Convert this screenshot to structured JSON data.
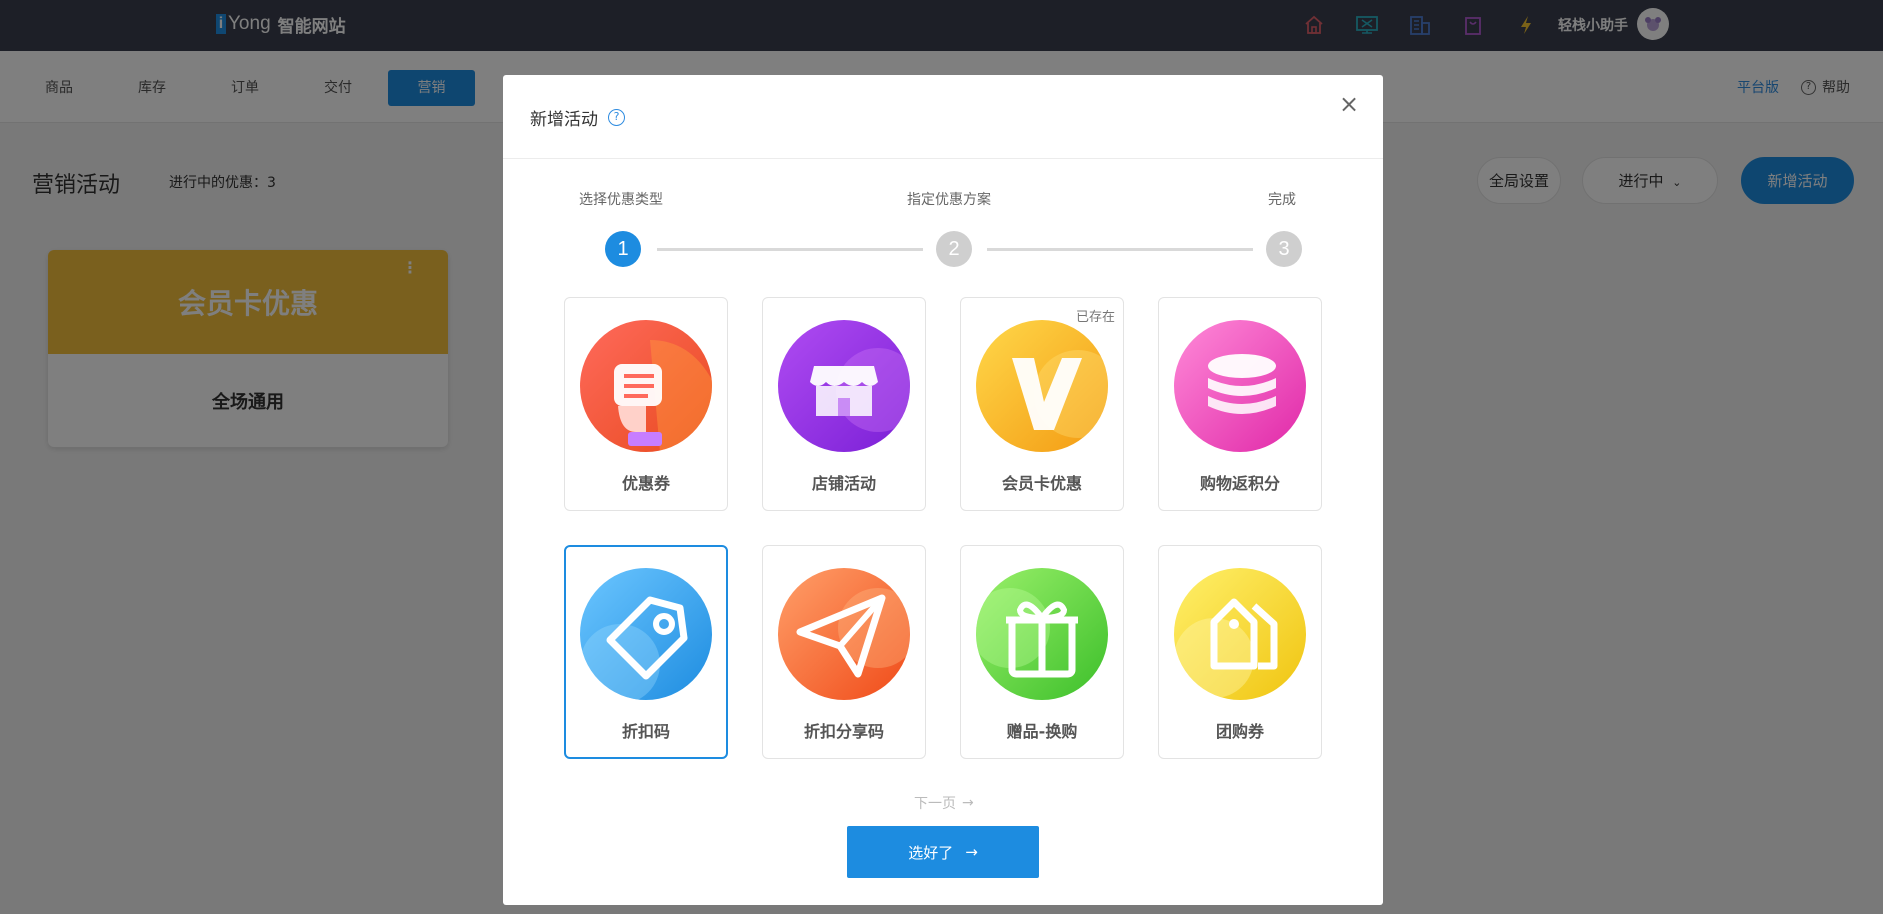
{
  "topbar": {
    "logo_i": "i",
    "logo_brand": "Yong",
    "logo_site": "智能网站",
    "icons": [
      "home-icon",
      "monitor-icon",
      "building-icon",
      "bag-icon",
      "lightning-icon"
    ],
    "assistant": "轻栈小助手"
  },
  "subnav": {
    "tabs": [
      "商品",
      "库存",
      "订单",
      "交付",
      "营销"
    ],
    "active_tab": "营销",
    "platform": "平台版",
    "help": "帮助"
  },
  "page": {
    "title": "营销活动",
    "ongoing_count": "进行中的优惠：3",
    "global_settings": "全局设置",
    "status_filter": "进行中",
    "new_activity": "新增活动"
  },
  "card": {
    "title": "会员卡优惠",
    "subtitle": "全场通用"
  },
  "modal": {
    "title": "新增活动",
    "steps": [
      {
        "label": "选择优惠类型",
        "number": "1"
      },
      {
        "label": "指定优惠方案",
        "number": "2"
      },
      {
        "label": "完成",
        "number": "3"
      }
    ],
    "current_step": 1,
    "types": [
      {
        "label": "优惠券",
        "icon": "coupon-icon"
      },
      {
        "label": "店铺活动",
        "icon": "shop-icon"
      },
      {
        "label": "会员卡优惠",
        "icon": "vip-card-icon",
        "tag": "已存在"
      },
      {
        "label": "购物返积分",
        "icon": "coin-stack-icon"
      },
      {
        "label": "折扣码",
        "icon": "tag-icon"
      },
      {
        "label": "折扣分享码",
        "icon": "paper-plane-icon"
      },
      {
        "label": "赠品-换购",
        "icon": "gift-icon"
      },
      {
        "label": "团购券",
        "icon": "group-tags-icon"
      }
    ],
    "selected_type": "折扣码",
    "next_page": "下一页",
    "confirm": "选好了"
  },
  "colors": {
    "accent": "#1d8ce0",
    "topbar": "#3a3f4e",
    "card_gold": "#f5c13c"
  }
}
